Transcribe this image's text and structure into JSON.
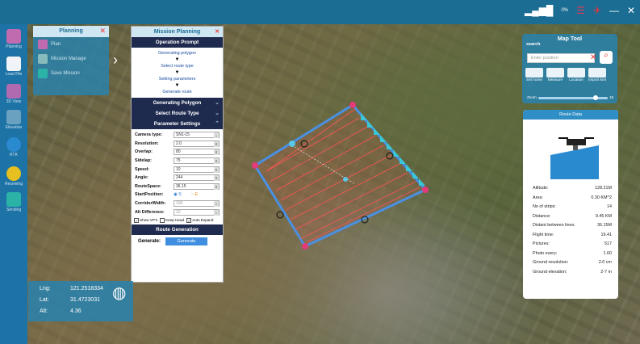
{
  "colors": {
    "topbar": "#1b6d93",
    "sidebar": "#1d72a6",
    "panel_header": "#1f2a4f",
    "accent": "#2f8ec5"
  },
  "sidebar": {
    "items": [
      {
        "label": "Planning",
        "icon": "planning-icon"
      },
      {
        "label": "Load File",
        "icon": "load-file-icon"
      },
      {
        "label": "3D View",
        "icon": "cube-icon"
      },
      {
        "label": "Elevation",
        "icon": "elevation-icon"
      },
      {
        "label": "RTK",
        "icon": "rtk-icon"
      },
      {
        "label": "Receiving",
        "icon": "receiving-icon"
      },
      {
        "label": "Sending",
        "icon": "sending-icon"
      }
    ]
  },
  "topbar": {
    "signal": "0%"
  },
  "planning": {
    "title": "Planning",
    "items": [
      {
        "label": "Plan"
      },
      {
        "label": "Mission Manage"
      },
      {
        "label": "Save Mission"
      }
    ]
  },
  "mission": {
    "title": "Mission Planning",
    "operation_prompt": "Operation Prompt",
    "steps": [
      "Generating polygon",
      "Select route type",
      "Setting parameters",
      "Generate route"
    ],
    "generating_polygon": "Generating Polygon",
    "select_route_type": "Select Route Type",
    "parameter_settings": "Parameter Settings",
    "params": [
      {
        "label": "Camera type:",
        "value": "SN1-15"
      },
      {
        "label": "Resolution:",
        "value": "2.0"
      },
      {
        "label": "Overlap:",
        "value": "80"
      },
      {
        "label": "Sidelap:",
        "value": "75"
      },
      {
        "label": "Speed:",
        "value": "10"
      },
      {
        "label": "Angle:",
        "value": "244"
      },
      {
        "label": "RouteSpace:",
        "value": "36.15"
      },
      {
        "label": "StartPosition:",
        "value": "S"
      },
      {
        "label": "CorridorWidth:",
        "value": "100"
      },
      {
        "label": "Alt Difference:",
        "value": "10"
      }
    ],
    "start_options": [
      "S",
      "E"
    ],
    "checks": [
      "Show VP's",
      "Keep Head",
      "Auto Expand"
    ],
    "route_generation": "Route Generation",
    "generate_label": "Generate:",
    "generate_button": "Generate"
  },
  "maptool": {
    "title": "Map Tool",
    "search_label": "search",
    "search_placeholder": "Enter position",
    "tools": [
      "Set home",
      "Measure",
      "Location",
      "Import kml"
    ],
    "zoom_label": "Zoom",
    "zoom_value": "18",
    "zoom_level": 0.85
  },
  "route_data": {
    "title": "Route Data",
    "rows": [
      {
        "k": "Altitude:",
        "v": "128.21M"
      },
      {
        "k": "Area:",
        "v": "0.30 KM^2"
      },
      {
        "k": "No of strips:",
        "v": "14"
      },
      {
        "k": "Distance:",
        "v": "9.45 KM"
      },
      {
        "k": "Distant between lines:",
        "v": "36.15M"
      },
      {
        "k": "Flight time:",
        "v": "19.41"
      },
      {
        "k": "Pictures:",
        "v": "517"
      },
      {
        "k": "Photo every:",
        "v": "1.60"
      },
      {
        "k": "Ground resolution:",
        "v": "2.0 cm"
      },
      {
        "k": "Ground elevation:",
        "v": "2-7 m"
      }
    ]
  },
  "coords": {
    "lng_label": "Lng:",
    "lng": "121.2518334",
    "lat_label": "Lat:",
    "lat": "31.4723031",
    "alt_label": "Alt:",
    "alt": "4.36"
  }
}
